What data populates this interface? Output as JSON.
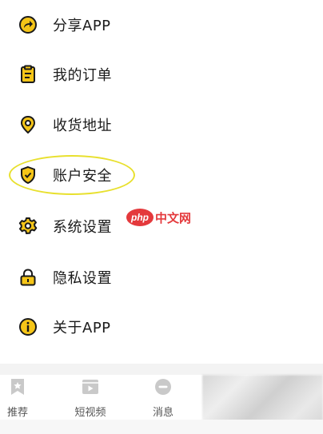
{
  "menu": {
    "items": [
      {
        "label": "分享APP",
        "icon": "share-icon"
      },
      {
        "label": "我的订单",
        "icon": "clipboard-icon"
      },
      {
        "label": "收货地址",
        "icon": "location-pin-icon"
      },
      {
        "label": "账户安全",
        "icon": "shield-check-icon"
      },
      {
        "label": "系统设置",
        "icon": "gear-icon"
      },
      {
        "label": "隐私设置",
        "icon": "lock-icon"
      },
      {
        "label": "关于APP",
        "icon": "info-icon"
      }
    ]
  },
  "watermark": {
    "logo_text": "php",
    "site_text": "中文网"
  },
  "tabbar": {
    "tabs": [
      {
        "label": "推荐",
        "icon": "star-bookmark-icon"
      },
      {
        "label": "短视频",
        "icon": "video-icon"
      },
      {
        "label": "消息",
        "icon": "message-icon"
      }
    ]
  },
  "colors": {
    "icon_fill": "#f5c518",
    "icon_stroke": "#1a1a1a",
    "highlight": "#e8e02e",
    "watermark": "#e4393c"
  }
}
